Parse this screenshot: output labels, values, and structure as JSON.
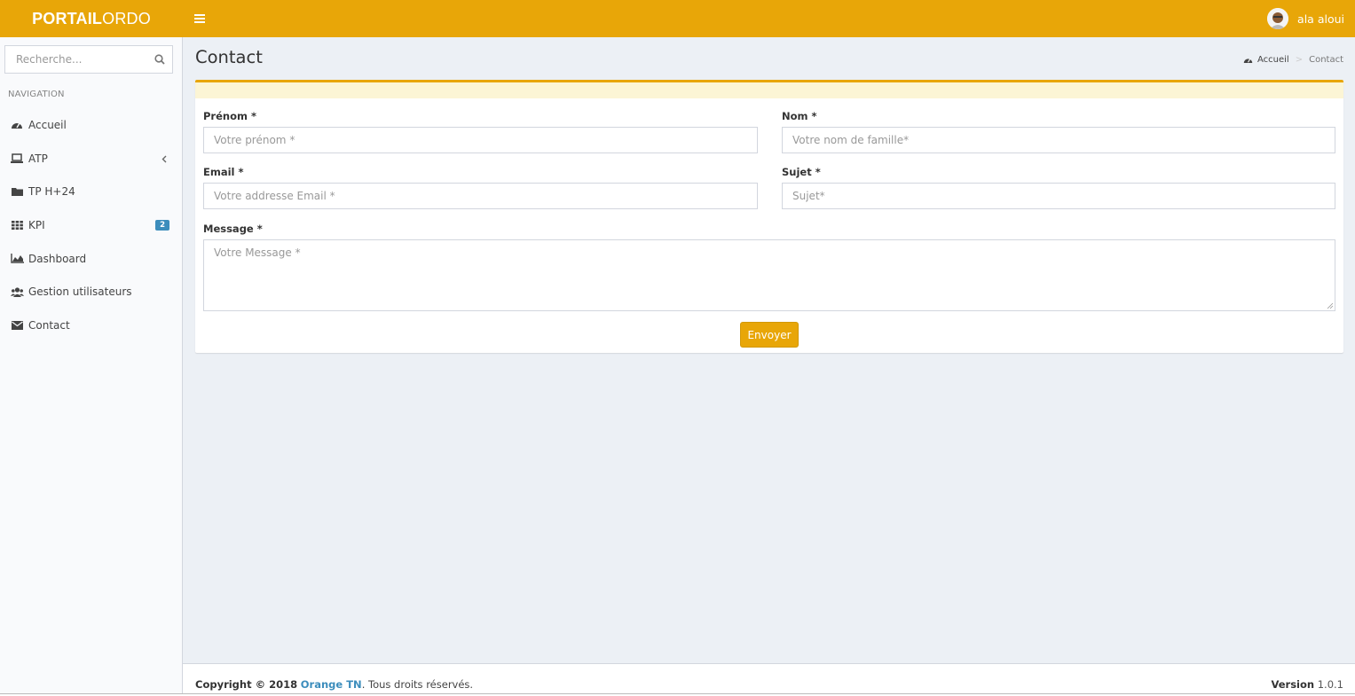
{
  "header": {
    "logo_bold": "PORTAIL",
    "logo_light": "ORDO",
    "user_name": "ala aloui",
    "accent_color": "#e8a608"
  },
  "sidebar": {
    "search_placeholder": "Recherche...",
    "nav_header": "NAVIGATION",
    "items": [
      {
        "label": "Accueil",
        "icon": "dashboard-icon"
      },
      {
        "label": "ATP",
        "icon": "laptop-icon",
        "has_submenu": true
      },
      {
        "label": "TP H+24",
        "icon": "folder-icon"
      },
      {
        "label": "KPI",
        "icon": "grid-icon",
        "badge": "2"
      },
      {
        "label": "Dashboard",
        "icon": "area-chart-icon"
      },
      {
        "label": "Gestion utilisateurs",
        "icon": "users-icon"
      },
      {
        "label": "Contact",
        "icon": "envelope-icon"
      }
    ]
  },
  "page": {
    "title": "Contact",
    "breadcrumb": {
      "home": "Accueil",
      "current": "Contact"
    }
  },
  "form": {
    "prenom": {
      "label": "Prénom *",
      "placeholder": "Votre prénom *"
    },
    "nom": {
      "label": "Nom *",
      "placeholder": "Votre nom de famille*"
    },
    "email": {
      "label": "Email *",
      "placeholder": "Votre addresse Email *"
    },
    "sujet": {
      "label": "Sujet *",
      "placeholder": "Sujet*"
    },
    "message": {
      "label": "Message *",
      "placeholder": "Votre Message *"
    },
    "submit_label": "Envoyer"
  },
  "footer": {
    "copyright_prefix": "Copyright © 2018",
    "company": "Orange TN",
    "rights": ". Tous droits réservés.",
    "version_label": "Version",
    "version_value": "1.0.1"
  }
}
